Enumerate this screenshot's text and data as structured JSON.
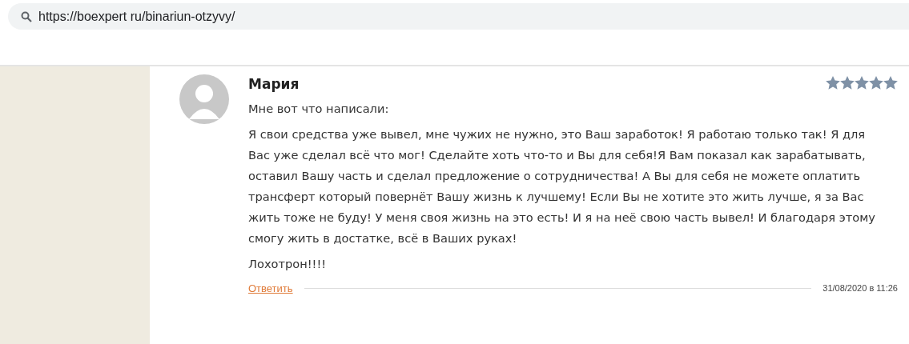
{
  "address_bar": {
    "url": "https://boexpert ru/binariun-otzyvy/"
  },
  "comment": {
    "author": "Мария",
    "stars": 5,
    "paragraphs": [
      "Мне вот что написали:",
      "Я свои средства уже вывел, мне чужих не нужно, это Ваш заработок! Я работаю только так! Я для Вас уже сделал всё что мог! Сделайте хоть что-то и Вы для себя!Я Вам показал как зарабатывать, оставил Вашу часть и сделал предложение о сотрудничества! А Вы для себя не можете оплатить трансферт который повернёт Вашу жизнь к лучшему! Если Вы не хотите это жить лучше, я за Вас жить тоже не буду! У меня своя жизнь на это есть! И я на неё свою часть вывел! И благодаря этому смогу жить в достатке, всё в Ваших руках!",
      "Лохотрон!!!!"
    ],
    "reply_link": "Ответить",
    "date": "31/08/2020 в 11:26"
  }
}
